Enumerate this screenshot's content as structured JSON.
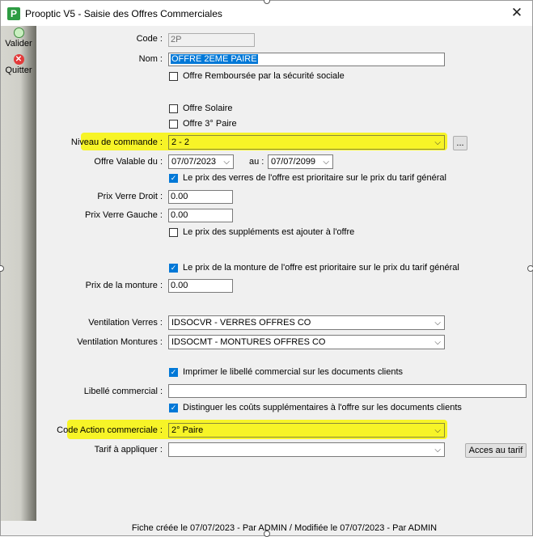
{
  "window": {
    "title": "Prooptic V5 - Saisie des Offres Commerciales",
    "app_icon": "P"
  },
  "sidebar": {
    "validate_label": "Valider",
    "quit_label": "Quitter"
  },
  "form": {
    "code": {
      "label": "Code :",
      "value": "2P"
    },
    "nom": {
      "label": "Nom :",
      "value": "OFFRE 2EME PAIRE"
    },
    "offre_remboursee": {
      "label": "Offre Remboursée par  la sécurité sociale",
      "checked": false
    },
    "offre_solaire": {
      "label": "Offre Solaire",
      "checked": false
    },
    "offre_3paire": {
      "label": "Offre 3° Paire",
      "checked": false
    },
    "niveau_commande": {
      "label": "Niveau de commande :",
      "value": "2 - 2",
      "button": "..."
    },
    "offre_valable": {
      "label": "Offre Valable du :",
      "from": "07/07/2023",
      "to_label": "au :",
      "to": "07/07/2099"
    },
    "prix_verres_prioritaire": {
      "label": "Le prix des verres de l'offre est prioritaire sur le prix du tarif général",
      "checked": true
    },
    "prix_verre_droit": {
      "label": "Prix Verre Droit :",
      "value": "0.00"
    },
    "prix_verre_gauche": {
      "label": "Prix Verre Gauche :",
      "value": "0.00"
    },
    "prix_supplements": {
      "label": "Le prix des suppléments est ajouter à l'offre",
      "checked": false
    },
    "prix_monture_prioritaire": {
      "label": "Le prix de la monture de l'offre est prioritaire sur le prix du tarif général",
      "checked": true
    },
    "prix_monture": {
      "label": "Prix de la monture :",
      "value": "0.00"
    },
    "ventilation_verres": {
      "label": "Ventilation Verres :",
      "value": "IDSOCVR - VERRES OFFRES CO"
    },
    "ventilation_montures": {
      "label": "Ventilation Montures :",
      "value": "IDSOCMT - MONTURES OFFRES CO"
    },
    "imprimer_libelle": {
      "label": "Imprimer le libellé commercial sur les documents clients",
      "checked": true
    },
    "libelle_commercial": {
      "label": "Libellé commercial :",
      "value": ""
    },
    "distinguer_couts": {
      "label": "Distinguer les coûts supplémentaires à l'offre sur les documents clients",
      "checked": true
    },
    "code_action": {
      "label": "Code Action commerciale :",
      "value": "2° Paire"
    },
    "tarif": {
      "label": "Tarif à appliquer :",
      "value": "",
      "button": "Acces au tarif"
    }
  },
  "status_bar": {
    "text": "Fiche créée le 07/07/2023 - Par ADMIN / Modifiée le 07/07/2023 - Par ADMIN"
  },
  "colors": {
    "highlight": "#f7f427",
    "checkbox_checked": "#0078d7",
    "app_icon": "#2e9c43"
  }
}
